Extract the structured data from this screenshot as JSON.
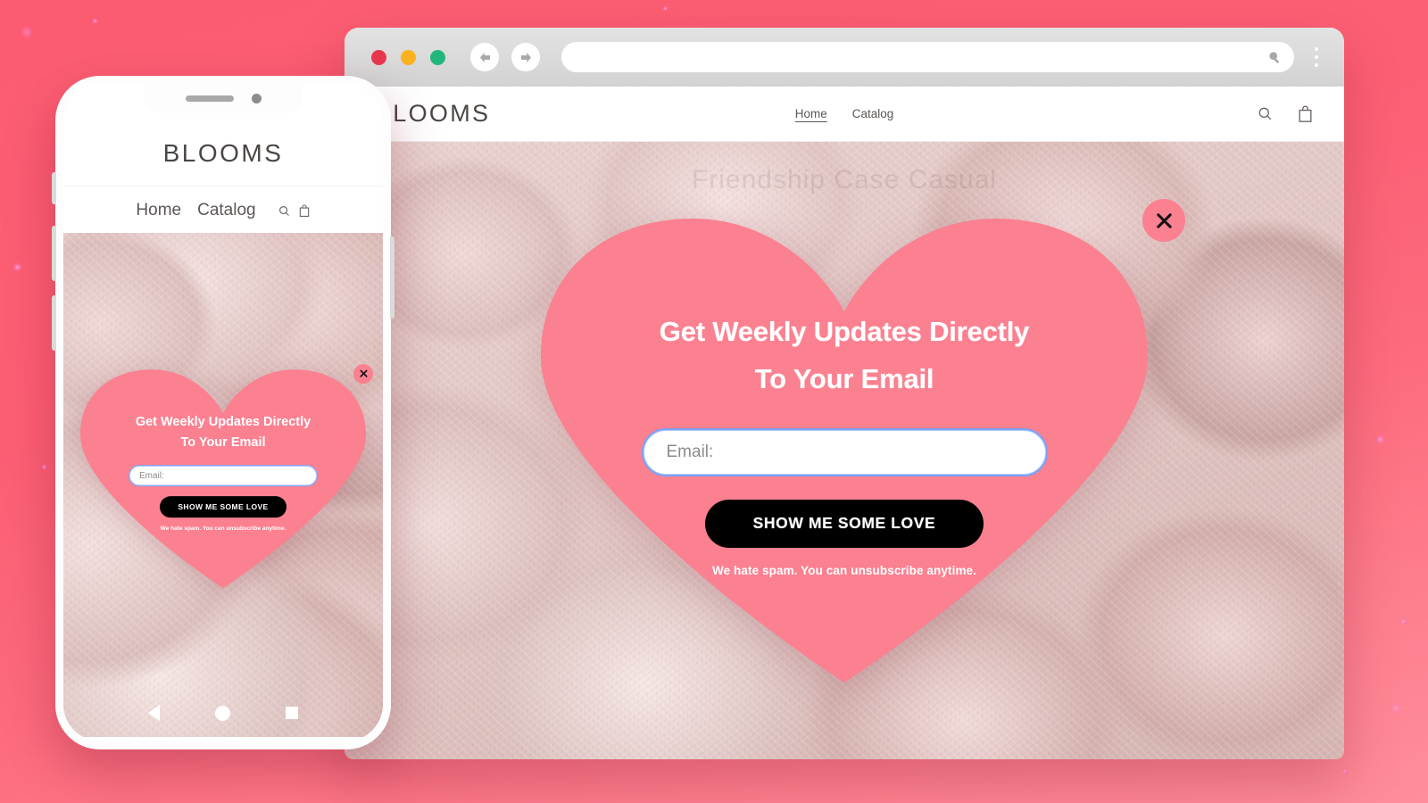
{
  "background": {
    "accent_top": "#fc5c72",
    "accent_bottom": "#ff8d9b"
  },
  "browser": {
    "traffic_lights": [
      {
        "name": "close",
        "color": "#e8384f"
      },
      {
        "name": "minimize",
        "color": "#fbb11e"
      },
      {
        "name": "maximize",
        "color": "#23b67c"
      }
    ],
    "back_icon": "arrow-left-icon",
    "forward_icon": "arrow-right-icon",
    "url_value": "",
    "url_placeholder": "",
    "url_search_icon": "search-icon",
    "menu_icon": "kebab-menu-icon"
  },
  "site": {
    "brand": "BLOOMS",
    "nav": [
      {
        "label": "Home",
        "active": true
      },
      {
        "label": "Catalog",
        "active": false
      }
    ],
    "icons": [
      {
        "name": "search-icon"
      },
      {
        "name": "shopping-bag-icon"
      }
    ],
    "hero_caption": "Friendship Case Casual"
  },
  "popup": {
    "heart_color": "#fb8090",
    "title_line1": "Get Weekly Updates Directly",
    "title_line2": "To Your Email",
    "email_value": "",
    "email_placeholder": "Email:",
    "submit_label": "SHOW ME SOME LOVE",
    "disclaimer": "We hate spam. You can unsubscribe anytime.",
    "close_icon": "close-icon"
  },
  "phone": {
    "brand": "BLOOMS",
    "nav": [
      {
        "label": "Home"
      },
      {
        "label": "Catalog"
      }
    ],
    "icons": [
      {
        "name": "search-icon"
      },
      {
        "name": "shopping-bag-icon"
      }
    ],
    "carousel": {
      "prev_icon": "triangle-left-icon",
      "dot_icon": "circle-dot-icon",
      "square_icon": "square-icon"
    }
  }
}
